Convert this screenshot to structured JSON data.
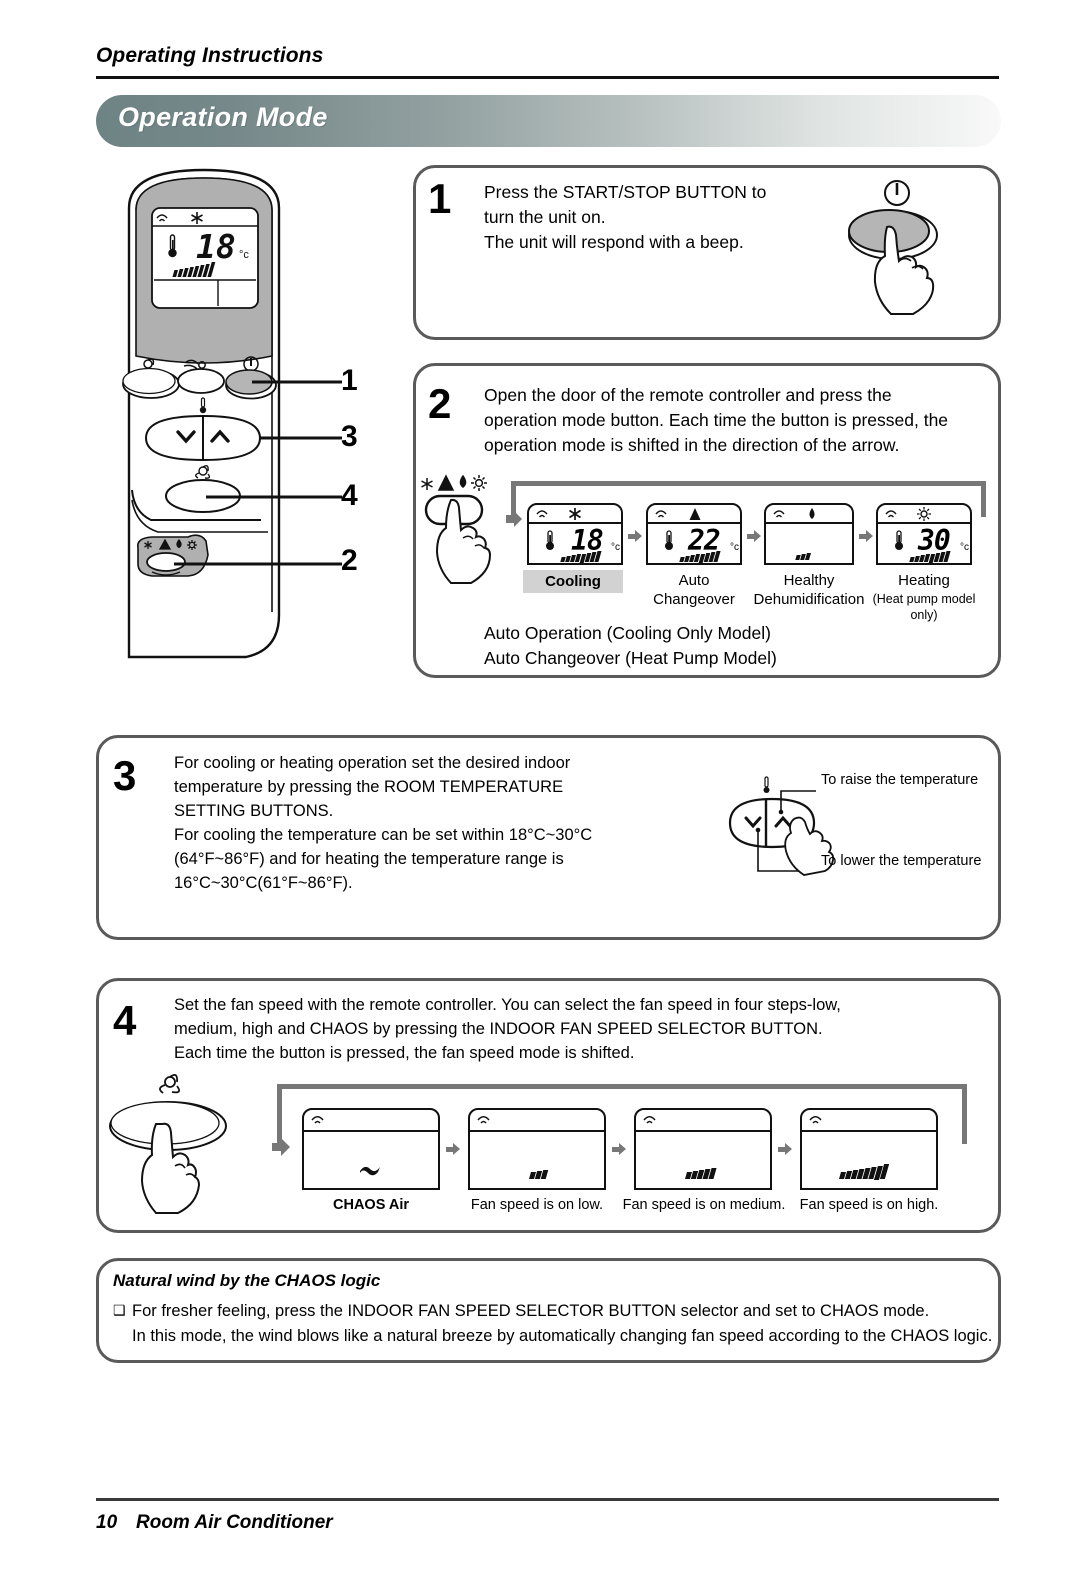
{
  "header": {
    "running_title": "Operating Instructions",
    "banner_title": "Operation Mode"
  },
  "remote": {
    "display": {
      "temp": "18",
      "unit": "c",
      "mode_icon": "snowflake-icon",
      "signal_icon": "signal-icon"
    },
    "callouts": [
      "1",
      "3",
      "4",
      "2"
    ],
    "buttons": [
      "jet-swirl-button",
      "air-flow-button",
      "power-button",
      "temp-down-button",
      "temp-up-button",
      "fan-speed-button",
      "operation-mode-button"
    ]
  },
  "steps": [
    {
      "num": "1",
      "lines": [
        "Press the START/STOP BUTTON to",
        "turn the unit on.",
        "The unit will respond with a beep."
      ]
    },
    {
      "num": "2",
      "lines": [
        "Open the door of the remote controller and press the",
        "operation mode button. Each time the button is pressed, the",
        "operation mode is shifted in the direction of the arrow."
      ],
      "footnotes": [
        "Auto Operation (Cooling Only Model)",
        "Auto Changeover (Heat Pump Model)"
      ],
      "modes": [
        {
          "icon": "snowflake-icon",
          "temp": "18",
          "unit": "c",
          "bars": 8,
          "label1": "Cooling",
          "label2": "",
          "label3": "",
          "highlight": true
        },
        {
          "icon": "auto-triangle-icon",
          "temp": "22",
          "unit": "c",
          "bars": 8,
          "label1": "Auto",
          "label2": "Changeover",
          "label3": "",
          "highlight": false
        },
        {
          "icon": "water-drop-icon",
          "temp": "",
          "unit": "",
          "bars": 3,
          "label1": "Healthy",
          "label2": "Dehumidification",
          "label3": "",
          "highlight": false
        },
        {
          "icon": "sun-icon",
          "temp": "30",
          "unit": "c",
          "bars": 8,
          "label1": "Heating",
          "label2": "",
          "label3": "(Heat pump model only)",
          "highlight": false
        }
      ]
    },
    {
      "num": "3",
      "lines": [
        "For cooling or heating operation set the desired indoor",
        "temperature by pressing the ROOM TEMPERATURE",
        "SETTING BUTTONS.",
        "For cooling the temperature can be set within 18°C~30°C",
        "(64°F~86°F) and for heating the temperature range is",
        "16°C~30°C(61°F~86°F)."
      ],
      "raise_label": "To raise the temperature",
      "lower_label": "To lower the temperature"
    },
    {
      "num": "4",
      "lines": [
        "Set the fan speed with the remote controller. You can select the fan speed in four steps-low,",
        "medium, high and CHAOS by pressing the INDOOR FAN SPEED SELECTOR BUTTON.",
        "Each time the button is pressed, the fan speed mode is shifted."
      ],
      "fan_modes": [
        {
          "icon": "chaos-wave-icon",
          "bars": 0,
          "label": "CHAOS Air",
          "bold": true
        },
        {
          "icon": "",
          "bars": 3,
          "label": "Fan speed is on low.",
          "bold": false
        },
        {
          "icon": "",
          "bars": 5,
          "label": "Fan speed is on medium.",
          "bold": false
        },
        {
          "icon": "",
          "bars": 8,
          "label": "Fan speed is on high.",
          "bold": false
        }
      ]
    }
  ],
  "note": {
    "heading": "Natural wind by the CHAOS logic",
    "bullet": "❑",
    "line1": "For fresher feeling, press the INDOOR FAN SPEED SELECTOR BUTTON selector and set to CHAOS mode.",
    "line2": "In this mode, the wind blows like a natural breeze by automatically changing fan speed according to the CHAOS logic."
  },
  "footer": {
    "page": "10",
    "product": "Room Air Conditioner"
  }
}
